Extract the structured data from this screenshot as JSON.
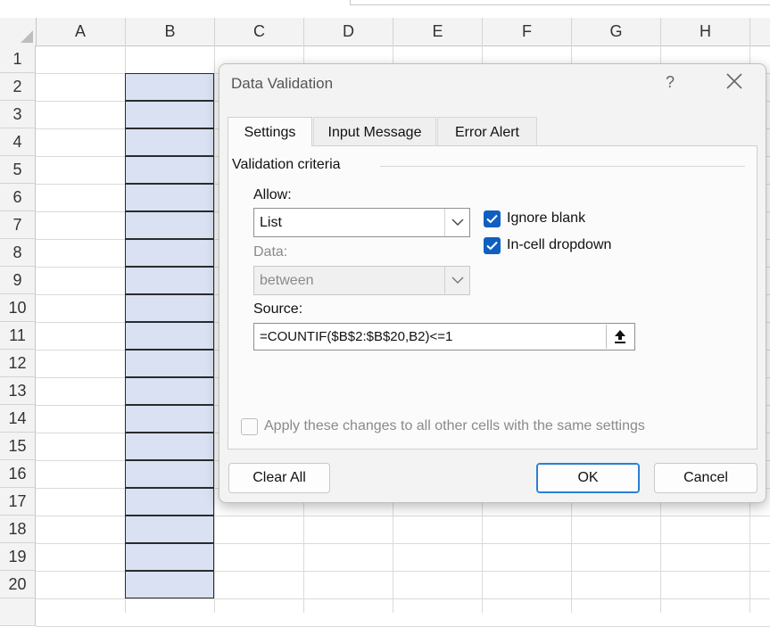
{
  "sheet": {
    "columns": [
      "A",
      "B",
      "C",
      "D",
      "E",
      "F",
      "G",
      "H"
    ],
    "rows": [
      "1",
      "2",
      "3",
      "4",
      "5",
      "6",
      "7",
      "8",
      "9",
      "10",
      "11",
      "12",
      "13",
      "14",
      "15",
      "16",
      "17",
      "18",
      "19",
      "20"
    ],
    "highlight_color": "#d9e1f2"
  },
  "dialog": {
    "title": "Data Validation",
    "help": "?",
    "tabs": [
      "Settings",
      "Input Message",
      "Error Alert"
    ],
    "active_tab": "Settings",
    "group_title": "Validation criteria",
    "allow_label": "Allow:",
    "allow_value": "List",
    "data_label": "Data:",
    "data_value": "between",
    "ignore_blank_label": "Ignore blank",
    "ignore_blank_checked": true,
    "in_cell_dropdown_label": "In-cell dropdown",
    "in_cell_dropdown_checked": true,
    "source_label": "Source:",
    "source_value": "=COUNTIF($B$2:$B$20,B2)<=1",
    "apply_all_label": "Apply these changes to all other cells with the same settings",
    "apply_all_checked": false,
    "clear_all_label": "Clear All",
    "ok_label": "OK",
    "cancel_label": "Cancel",
    "accent_color": "#0f5fc1"
  }
}
